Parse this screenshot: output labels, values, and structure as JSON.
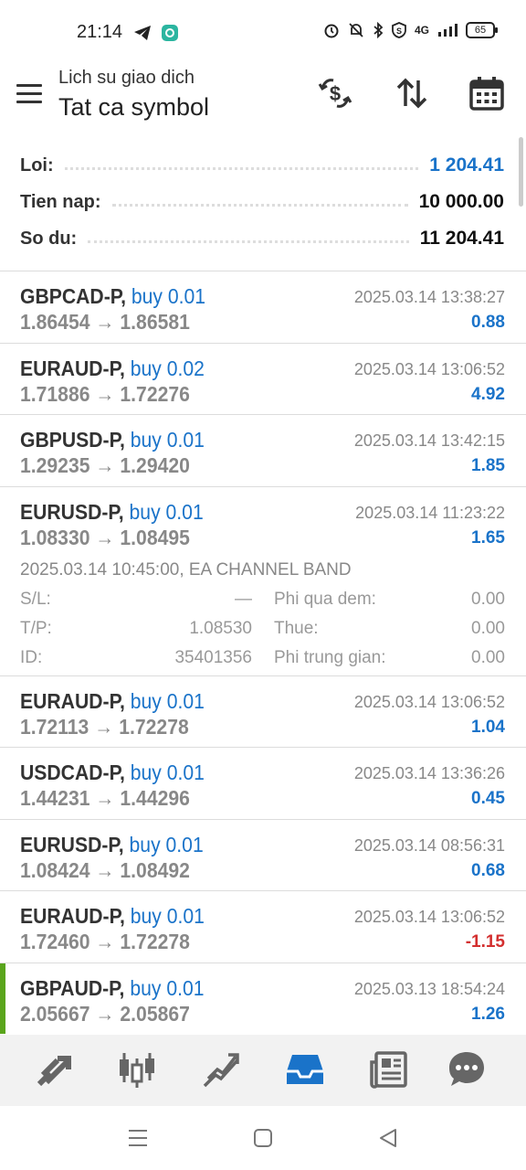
{
  "status": {
    "time": "21:14",
    "network": "4G",
    "battery": "65"
  },
  "header": {
    "subtitle": "Lich su giao dich",
    "title": "Tat ca symbol"
  },
  "summary": [
    {
      "label": "Loi:",
      "value": "1 204.41",
      "highlight": true
    },
    {
      "label": "Tien nap:",
      "value": "10 000.00",
      "highlight": false
    },
    {
      "label": "So du:",
      "value": "11 204.41",
      "highlight": false
    }
  ],
  "deals": [
    {
      "symbol": "GBPCAD-P,",
      "type": "buy 0.01",
      "prices": "1.86454 → 1.86581",
      "time": "2025.03.14 13:38:27",
      "profit": "0.88"
    },
    {
      "symbol": "EURAUD-P,",
      "type": "buy 0.02",
      "prices": "1.71886 → 1.72276",
      "time": "2025.03.14 13:06:52",
      "profit": "4.92"
    },
    {
      "symbol": "GBPUSD-P,",
      "type": "buy 0.01",
      "prices": "1.29235 → 1.29420",
      "time": "2025.03.14 13:42:15",
      "profit": "1.85"
    },
    {
      "symbol": "EURUSD-P,",
      "type": "buy 0.01",
      "prices": "1.08330 → 1.08495",
      "time": "2025.03.14 11:23:22",
      "profit": "1.65"
    },
    {
      "symbol": "EURAUD-P,",
      "type": "buy 0.01",
      "prices": "1.72113 → 1.72278",
      "time": "2025.03.14 13:06:52",
      "profit": "1.04"
    },
    {
      "symbol": "USDCAD-P,",
      "type": "buy 0.01",
      "prices": "1.44231 → 1.44296",
      "time": "2025.03.14 13:36:26",
      "profit": "0.45"
    },
    {
      "symbol": "EURUSD-P,",
      "type": "buy 0.01",
      "prices": "1.08424 → 1.08492",
      "time": "2025.03.14 08:56:31",
      "profit": "0.68"
    },
    {
      "symbol": "EURAUD-P,",
      "type": "buy 0.01",
      "prices": "1.72460 → 1.72278",
      "time": "2025.03.14 13:06:52",
      "profit": "-1.15"
    },
    {
      "symbol": "GBPAUD-P,",
      "type": "buy 0.01",
      "prices": "2.05667 → 2.05867",
      "time": "2025.03.13 18:54:24",
      "profit": "1.26"
    }
  ],
  "expanded_deal": {
    "comment": "2025.03.14 10:45:00, EA CHANNEL BAND",
    "sl_label": "S/L:",
    "sl_value": "—",
    "tp_label": "T/P:",
    "tp_value": "1.08530",
    "id_label": "ID:",
    "id_value": "35401356",
    "swap_label": "Phi qua dem:",
    "swap_value": "0.00",
    "tax_label": "Thue:",
    "tax_value": "0.00",
    "commission_label": "Phi trung gian:",
    "commission_value": "0.00"
  },
  "colors": {
    "accent_blue": "#1a73c9",
    "negative_red": "#d32f2f",
    "marker_green": "#5aa51c"
  },
  "bottom_nav": [
    "trade-icon",
    "quotes-candles-icon",
    "chart-icon",
    "history-inbox-icon",
    "news-icon",
    "chat-icon"
  ]
}
